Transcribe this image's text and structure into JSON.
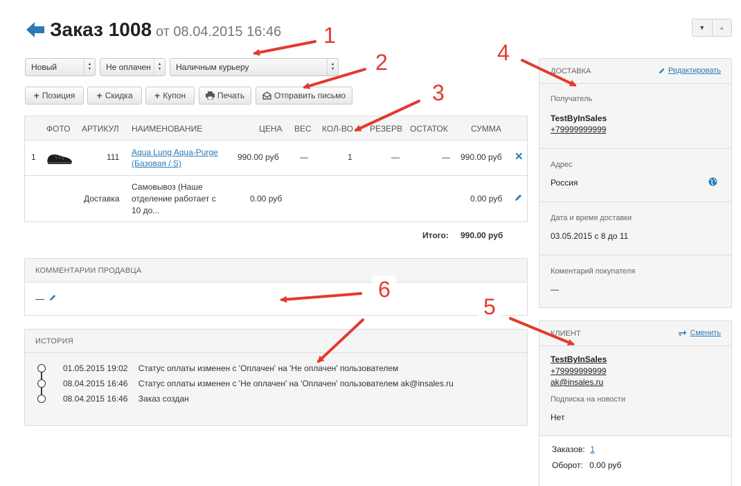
{
  "header": {
    "title": "Заказ 1008",
    "date": "от 08.04.2015 16:46"
  },
  "selects": {
    "status": "Новый",
    "payment": "Не оплачен",
    "delivery": "Наличным курьеру"
  },
  "toolbar": {
    "position": "Позиция",
    "discount": "Скидка",
    "coupon": "Купон",
    "print": "Печать",
    "send_letter": "Отправить письмо"
  },
  "items_table": {
    "headers": {
      "photo": "ФОТО",
      "sku": "АРТИКУЛ",
      "name": "НАИМЕНОВАНИЕ",
      "price": "ЦЕНА",
      "weight": "ВЕС",
      "qty": "КОЛ-ВО",
      "reserve": "РЕЗЕРВ",
      "stock": "ОСТАТОК",
      "sum": "СУММА"
    },
    "row1": {
      "num": "1",
      "sku": "111",
      "name_line1": "Aqua Lung Aqua-Purge",
      "name_line2": "(Базовая / S)",
      "price": "990.00 руб",
      "weight": "—",
      "qty": "1",
      "reserve": "—",
      "stock": "—",
      "sum": "990.00 руб"
    },
    "row2": {
      "sku": "Доставка",
      "name_line1": "Самовывоз (Наше",
      "name_line2": "отделение работает с",
      "name_line3": "10 до...",
      "price": "0.00 руб",
      "sum": "0.00 руб"
    },
    "total_label": "Итого:",
    "total_value": "990.00 руб"
  },
  "seller_comments": {
    "title": "КОММЕНТАРИИ ПРОДАВЦА",
    "value": "—"
  },
  "history": {
    "title": "ИСТОРИЯ",
    "entries": [
      {
        "time": "01.05.2015 19:02",
        "text": "Статус оплаты изменен с 'Оплачен' на 'Не оплачен' пользователем"
      },
      {
        "time": "08.04.2015 16:46",
        "text": "Статус оплаты изменен с 'Не оплачен' на 'Оплачен' пользователем ak@insales.ru"
      },
      {
        "time": "08.04.2015 16:46",
        "text": "Заказ создан"
      }
    ]
  },
  "delivery_panel": {
    "title": "ДОСТАВКА",
    "edit": "Редактировать",
    "recipient_label": "Получатель",
    "recipient_name": "TestByInSales",
    "recipient_phone": "+79999999999",
    "address_label": "Адрес",
    "address_value": "Россия",
    "datetime_label": "Дата и время доставки",
    "datetime_value": "03.05.2015 с 8 до 11",
    "comment_label": "Коментарий покупателя",
    "comment_value": "—"
  },
  "client_panel": {
    "title": "КЛИЕНТ",
    "change": "Сменить",
    "name": "TestByInSales",
    "phone": "+79999999999",
    "email": "ak@insales.ru",
    "subscription_label": "Подписка на новости",
    "subscription_value": "Нет",
    "orders_label": "Заказов:",
    "orders_value": "1",
    "turnover_label": "Оборот:",
    "turnover_value": "0.00 руб"
  },
  "annotations": {
    "n1": "1",
    "n2": "2",
    "n3": "3",
    "n4": "4",
    "n5": "5",
    "n6": "6"
  },
  "colors": {
    "accent_blue": "#2a7ab8",
    "annotation_red": "#e33a2e"
  }
}
